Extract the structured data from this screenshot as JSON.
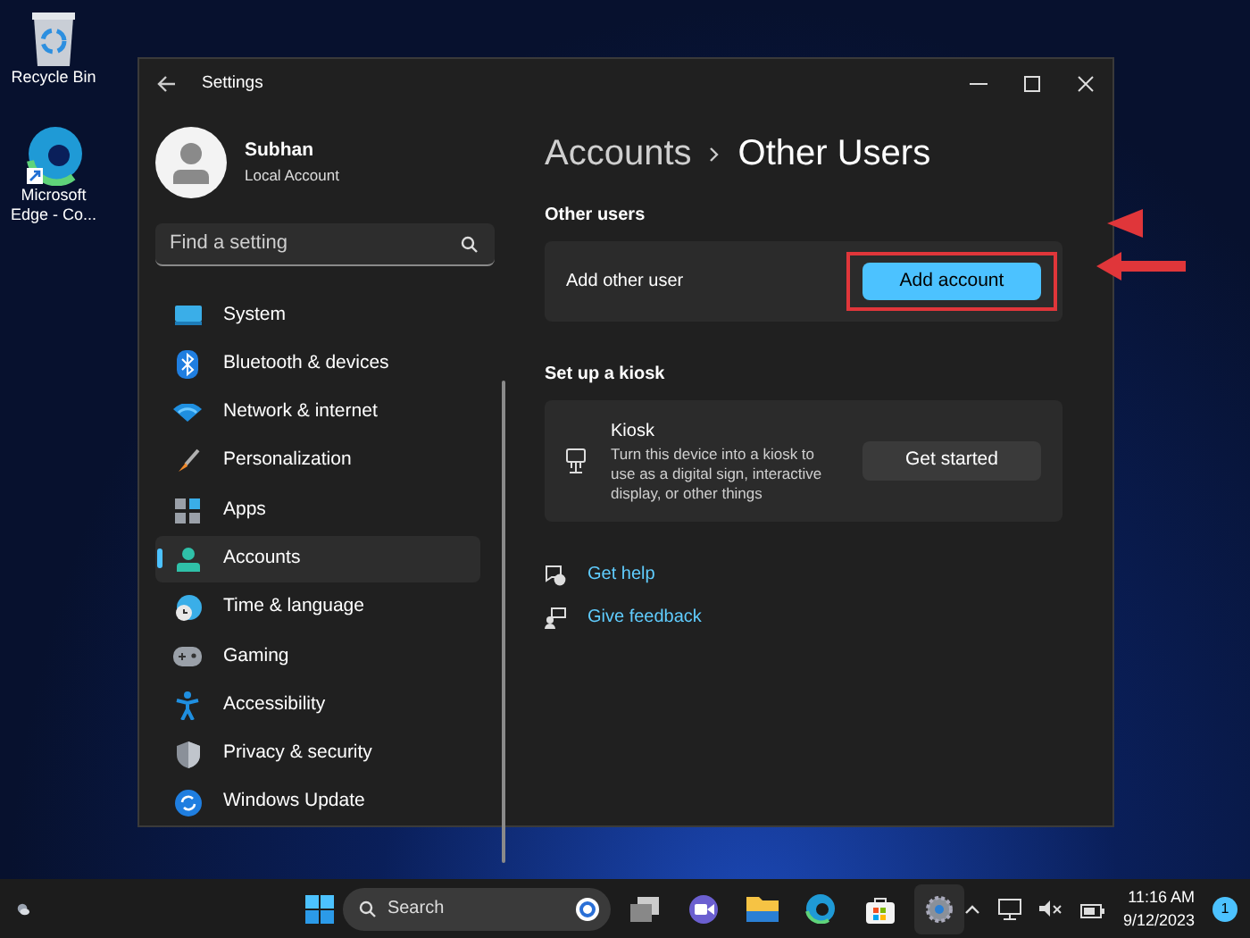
{
  "desktop_icons": [
    {
      "label": "Recycle Bin"
    },
    {
      "label": "Microsoft Edge - Co..."
    }
  ],
  "window": {
    "title": "Settings"
  },
  "profile": {
    "name": "Subhan",
    "account_type": "Local Account"
  },
  "search": {
    "placeholder": "Find a setting"
  },
  "sidebar": {
    "items": [
      {
        "label": "System",
        "selected": false
      },
      {
        "label": "Bluetooth & devices",
        "selected": false
      },
      {
        "label": "Network & internet",
        "selected": false
      },
      {
        "label": "Personalization",
        "selected": false
      },
      {
        "label": "Apps",
        "selected": false
      },
      {
        "label": "Accounts",
        "selected": true
      },
      {
        "label": "Time & language",
        "selected": false
      },
      {
        "label": "Gaming",
        "selected": false
      },
      {
        "label": "Accessibility",
        "selected": false
      },
      {
        "label": "Privacy & security",
        "selected": false
      },
      {
        "label": "Windows Update",
        "selected": false
      }
    ]
  },
  "breadcrumb": {
    "parent": "Accounts",
    "current": "Other Users"
  },
  "sections": [
    {
      "heading": "Other users",
      "card": {
        "kind": "simple",
        "title": "Add other user",
        "button": {
          "label": "Add account",
          "primary": true,
          "highlighted": true
        }
      }
    },
    {
      "heading": "Set up a kiosk",
      "card": {
        "kind": "detailed",
        "title": "Kiosk",
        "description": "Turn this device into a kiosk to use as a digital sign, interactive display, or other things",
        "button": {
          "label": "Get started",
          "primary": false,
          "highlighted": false
        }
      }
    }
  ],
  "links": [
    {
      "label": "Get help"
    },
    {
      "label": "Give feedback"
    }
  ],
  "taskbar": {
    "search_placeholder": "Search",
    "time": "11:16 AM",
    "date": "9/12/2023",
    "notification_count": "1"
  }
}
